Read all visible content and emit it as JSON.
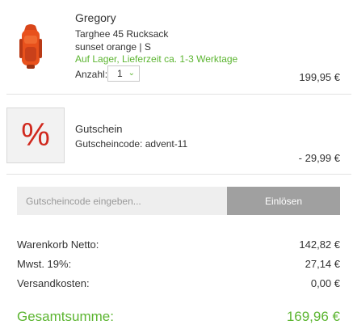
{
  "cart_item": {
    "brand": "Gregory",
    "product": "Targhee 45 Rucksack",
    "variant": "sunset orange | S",
    "availability": "Auf Lager, Lieferzeit ca. 1-3 Werktage",
    "quantity_label": "Anzahl:",
    "quantity_value": "1",
    "price": "199,95 €",
    "image_icon": "backpack-orange"
  },
  "voucher": {
    "icon": "percent",
    "title": "Gutschein",
    "code_line": "Gutscheincode: advent-11",
    "amount": "- 29,99 €"
  },
  "coupon_form": {
    "placeholder": "Gutscheincode eingeben...",
    "redeem_label": "Einlösen"
  },
  "summary": {
    "net_label": "Warenkorb Netto:",
    "net_value": "142,82 €",
    "tax_label": "Mwst. 19%:",
    "tax_value": "27,14 €",
    "shipping_label": "Versandkosten:",
    "shipping_value": "0,00 €",
    "total_label": "Gesamtsumme:",
    "total_value": "169,96 €"
  },
  "colors": {
    "accent_green": "#5cb531",
    "voucher_red": "#d0281d",
    "product_orange": "#e8511c"
  }
}
